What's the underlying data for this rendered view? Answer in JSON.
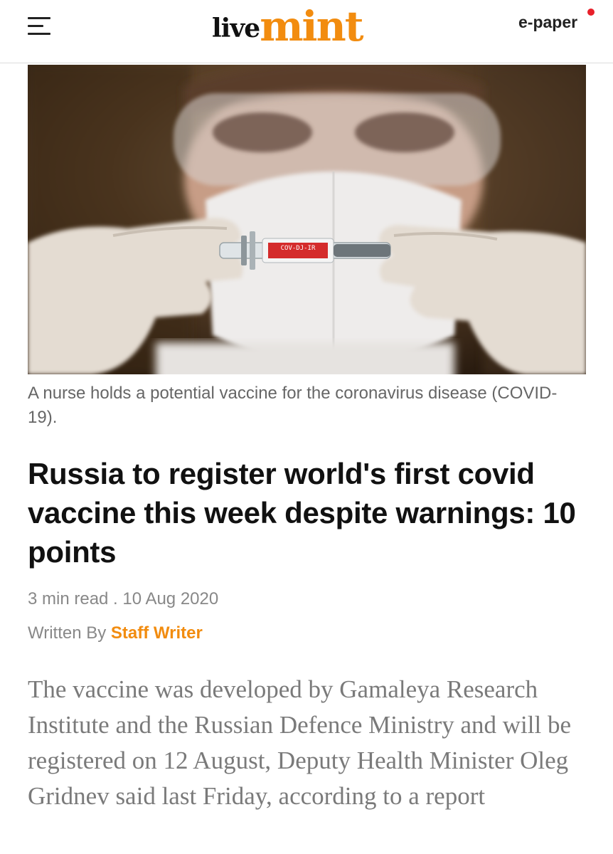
{
  "header": {
    "menu_icon": "hamburger-menu-icon",
    "logo_live": "live",
    "logo_mint": "mint",
    "epaper_label": "e-paper",
    "epaper_dot_color": "#e8202a",
    "brand_color": "#f28c0f"
  },
  "article": {
    "image_caption": "A nurse holds a potential vaccine for the coronavirus disease (COVID-19).",
    "vial_label": "COV-DJ-IR",
    "headline": "Russia to register world's first covid vaccine this week despite warnings: 10 points",
    "read_time": "3 min read",
    "separator": " . ",
    "date": "10 Aug 2020",
    "written_by_label": "Written By ",
    "author": "Staff Writer",
    "summary": "The vaccine was developed by Gamaleya Research Institute and the Russian Defence Ministry and will be registered on 12 August, Deputy Health Minister Oleg Gridnev said last Friday, according to a report"
  }
}
